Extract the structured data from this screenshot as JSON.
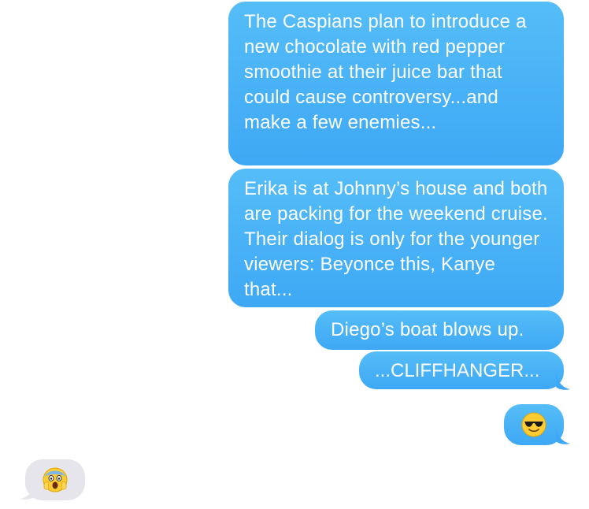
{
  "conversation": {
    "messages": [
      {
        "sender": "me",
        "text": "The Caspians plan to introduce a new chocolate with red pepper smoothie at their juice bar that could cause controversy...and make a few enemies..."
      },
      {
        "sender": "me",
        "text": "Erika is at Johnny’s house and both are packing for the weekend cruise. Their dialog is only for the younger viewers: Beyonce this, Kanye that..."
      },
      {
        "sender": "me",
        "text": "Diego’s boat blows up."
      },
      {
        "sender": "me",
        "text": "...CLIFFHANGER..."
      },
      {
        "sender": "me",
        "emoji": "sunglasses-face-emoji"
      },
      {
        "sender": "them",
        "emoji": "screaming-face-emoji"
      }
    ]
  },
  "colors": {
    "sent_bubble": "#4ab3f6",
    "received_bubble": "#e6e5eb",
    "background": "#ffffff"
  }
}
